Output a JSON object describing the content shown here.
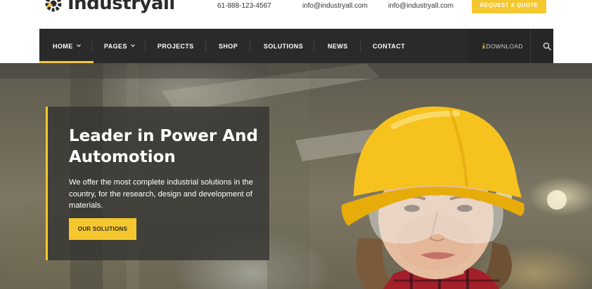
{
  "brand": {
    "logo_text": "Industryall",
    "accent_color": "#f5c72e",
    "dark_color": "#2a2a2a"
  },
  "topbar": {
    "phone": "61-888-123-4567",
    "email_primary": "info@industryall.com",
    "email_secondary": "info@industryall.com",
    "quote_button": "REQUEST A QUOTE"
  },
  "nav": {
    "items": [
      {
        "label": "HOME",
        "has_dropdown": true,
        "active": true
      },
      {
        "label": "PAGES",
        "has_dropdown": true,
        "active": false
      },
      {
        "label": "PROJECTS",
        "has_dropdown": false,
        "active": false
      },
      {
        "label": "SHOP",
        "has_dropdown": false,
        "active": false
      },
      {
        "label": "SOLUTIONS",
        "has_dropdown": false,
        "active": false
      },
      {
        "label": "NEWS",
        "has_dropdown": false,
        "active": false
      },
      {
        "label": "CONTACT",
        "has_dropdown": false,
        "active": false
      }
    ],
    "download_label": "DOWNLOAD",
    "download_icon": "download-arrow-icon",
    "search_icon": "search-icon"
  },
  "hero": {
    "title": "Leader in Power And Automotion",
    "description": "We offer the most complete industrial solutions in the country, for the research, design and development of materials.",
    "cta_label": "OUR SOLUTIONS"
  }
}
